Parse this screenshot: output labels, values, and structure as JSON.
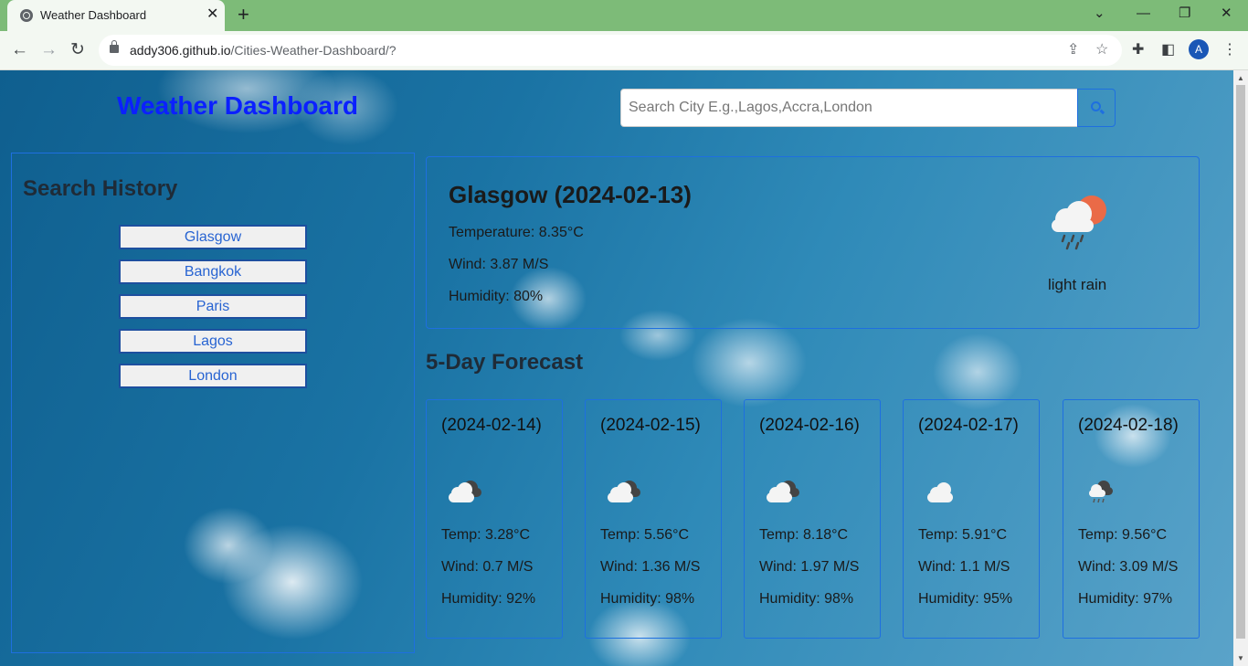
{
  "browser": {
    "tab_title": "Weather Dashboard",
    "url_domain": "addy306.github.io",
    "url_path": "/Cities-Weather-Dashboard/?",
    "profile_initial": "A"
  },
  "page": {
    "title": "Weather Dashboard",
    "search_placeholder": "Search City E.g.,Lagos,Accra,London",
    "history_title": "Search History",
    "history": [
      "Glasgow",
      "Bangkok",
      "Paris",
      "Lagos",
      "London"
    ],
    "current": {
      "heading": "Glasgow (2024-02-13)",
      "temperature": "Temperature: 8.35°C",
      "wind": "Wind: 3.87 M/S",
      "humidity": "Humidity: 80%",
      "description": "light rain",
      "icon": "rain-sun-icon"
    },
    "forecast_title": "5-Day Forecast",
    "forecast": [
      {
        "date": "(2024-02-14)",
        "icon": "broken-clouds-icon",
        "temp": "Temp: 3.28°C",
        "wind": "Wind: 0.7 M/S",
        "humidity": "Humidity: 92%"
      },
      {
        "date": "(2024-02-15)",
        "icon": "broken-clouds-icon",
        "temp": "Temp: 5.56°C",
        "wind": "Wind: 1.36 M/S",
        "humidity": "Humidity: 98%"
      },
      {
        "date": "(2024-02-16)",
        "icon": "broken-clouds-icon",
        "temp": "Temp: 8.18°C",
        "wind": "Wind: 1.97 M/S",
        "humidity": "Humidity: 98%"
      },
      {
        "date": "(2024-02-17)",
        "icon": "cloud-icon",
        "temp": "Temp: 5.91°C",
        "wind": "Wind: 1.1 M/S",
        "humidity": "Humidity: 95%"
      },
      {
        "date": "(2024-02-18)",
        "icon": "rain-cloud-icon",
        "temp": "Temp: 9.56°C",
        "wind": "Wind: 3.09 M/S",
        "humidity": "Humidity: 97%"
      }
    ]
  },
  "colors": {
    "accent": "#1e6fe0",
    "title": "#0b20ff",
    "tabbar": "#7dbb78"
  }
}
